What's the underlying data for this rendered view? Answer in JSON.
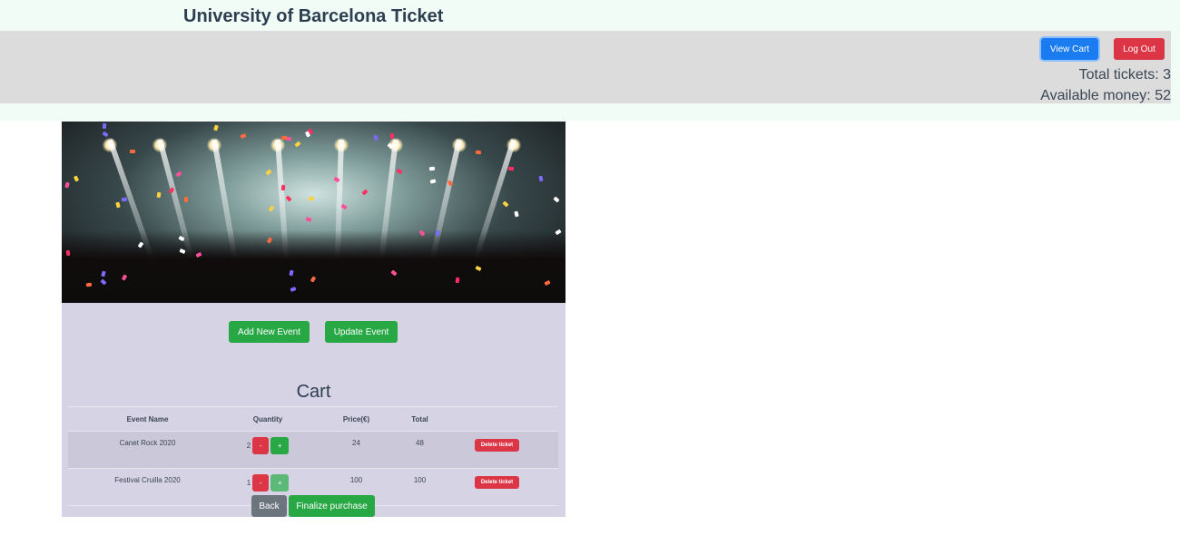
{
  "header": {
    "title": "University of Barcelona Ticket",
    "view_cart_label": "View Cart",
    "logout_label": "Log Out",
    "total_tickets_label": "Total tickets:",
    "total_tickets_value": "3",
    "available_money_label": "Available money:",
    "available_money_value": "52"
  },
  "actions": {
    "add_event_label": "Add New Event",
    "update_event_label": "Update Event"
  },
  "cart": {
    "title": "Cart",
    "columns": [
      "Event Name",
      "Quantity",
      "Price(€)",
      "Total",
      ""
    ],
    "rows": [
      {
        "event": "Canet Rock 2020",
        "quantity": "2",
        "minus": "-",
        "plus": "+",
        "price": "24",
        "total": "48",
        "delete": "Delete ticket"
      },
      {
        "event": "Festival Cruilla 2020",
        "quantity": "1",
        "minus": "-",
        "plus": "+",
        "price": "100",
        "total": "100",
        "delete": "Delete ticket"
      }
    ],
    "back_label": "Back",
    "finalize_label": "Finalize purchase"
  },
  "colors": {
    "primary": "#1a7cf0",
    "danger": "#dc3545",
    "success": "#28a745",
    "secondary": "#6c757d",
    "panel": "#d6d3e5",
    "header_bar": "#dcdcdc"
  }
}
